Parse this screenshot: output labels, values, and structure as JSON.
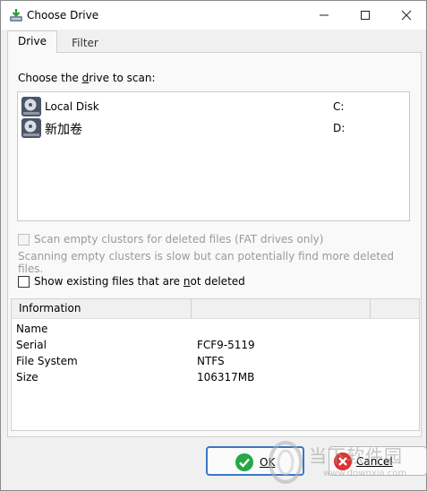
{
  "window": {
    "title": "Choose Drive",
    "controls": {
      "minimize": "minimize",
      "maximize": "maximize",
      "close": "close"
    }
  },
  "tabs": [
    {
      "label": "Drive",
      "active": true
    },
    {
      "label": "Filter",
      "active": false
    }
  ],
  "drive_tab": {
    "choose_label_pre": "Choose the ",
    "choose_label_u": "d",
    "choose_label_post": "rive to scan:",
    "drives": [
      {
        "name": "Local Disk",
        "letter": "C:",
        "icon": "hard-drive-icon"
      },
      {
        "name": "新加卷",
        "letter": "D:",
        "icon": "hard-drive-icon"
      }
    ],
    "scan_empty_label": "Scan empty clustors for deleted files (FAT drives only)",
    "scan_empty_checked": false,
    "scan_empty_note": "Scanning empty clusters is slow but can potentially find more deleted files.",
    "show_existing_pre": "Show existing files that are ",
    "show_existing_u": "n",
    "show_existing_post": "ot deleted",
    "show_existing_checked": false
  },
  "information": {
    "header": "Information",
    "rows": [
      {
        "key": "Name",
        "value": ""
      },
      {
        "key": "Serial",
        "value": "FCF9-5119"
      },
      {
        "key": "File System",
        "value": "NTFS"
      },
      {
        "key": "Size",
        "value": "106317MB"
      }
    ]
  },
  "buttons": {
    "ok_label": "OK",
    "cancel_label": "Cancel"
  },
  "watermark": {
    "text_cn": "当下软件园",
    "url": "www.downxia.com"
  },
  "colors": {
    "ok_border": "#3a76c4",
    "ok_icon": "#27a845",
    "cancel_icon": "#e03030"
  }
}
